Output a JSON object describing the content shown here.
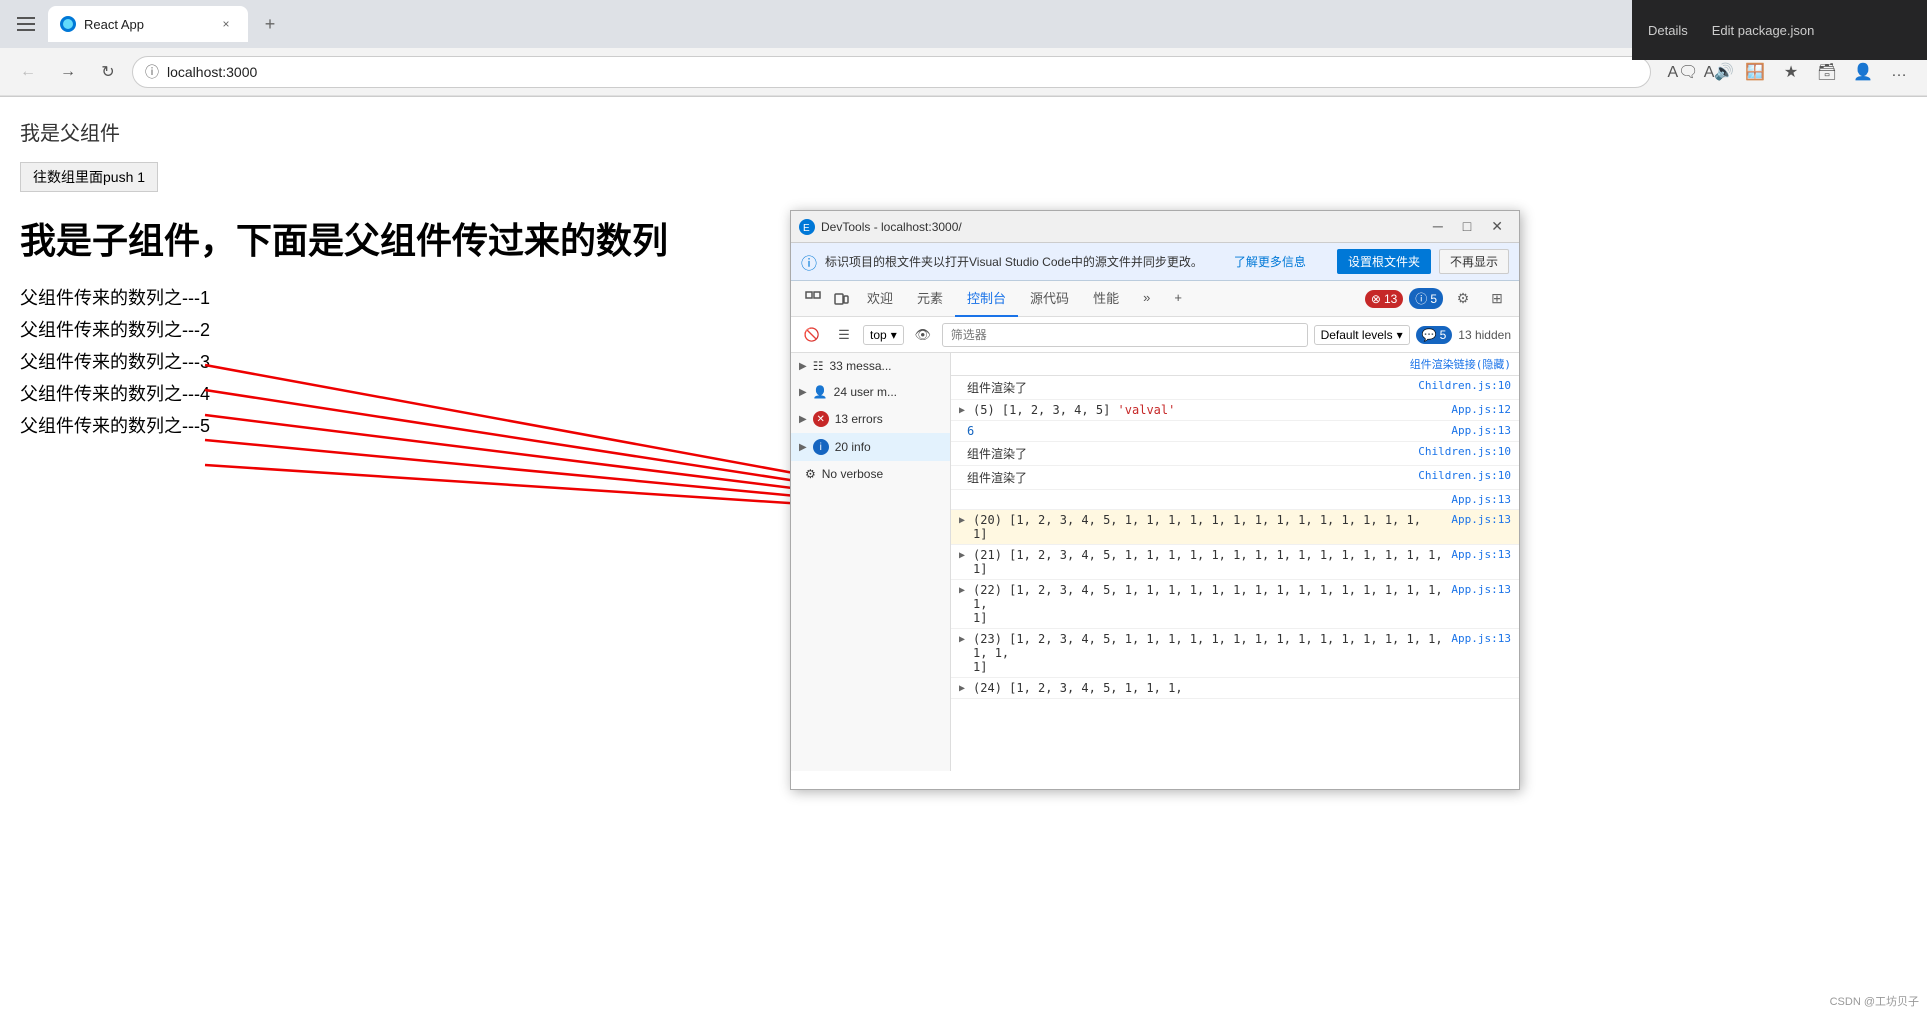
{
  "browser": {
    "tab_title": "React App",
    "tab_favicon": "R",
    "url": "localhost:3000",
    "new_tab_label": "+",
    "close_tab_label": "×"
  },
  "page": {
    "parent_label": "我是父组件",
    "push_button": "往数组里面push 1",
    "child_heading": "我是子组件，下面是父组件传过来的数列",
    "list_items": [
      "父组件传来的数列之---1",
      "父组件传来的数列之---2",
      "父组件传来的数列之---3",
      "父组件传来的数列之---4",
      "父组件传来的数列之---5"
    ]
  },
  "devtools": {
    "title": "DevTools - localhost:3000/",
    "info_bar_text": "标识项目的根文件夹以打开Visual Studio Code中的源文件并同步更改。",
    "info_bar_link": "了解更多信息",
    "btn_set_root": "设置根文件夹",
    "btn_no_more": "不再显示",
    "tabs": [
      "欢迎",
      "元素",
      "控制台",
      "源代码",
      "性能"
    ],
    "active_tab": "控制台",
    "badge_errors": "13",
    "badge_info": "5",
    "toolbar": {
      "top_label": "top",
      "filter_placeholder": "筛选器",
      "levels_label": "Default levels",
      "msg_count": "5",
      "hidden_count": "13 hidden"
    },
    "sidebar_items": [
      {
        "label": "33 messa...",
        "type": "list",
        "count": "33"
      },
      {
        "label": "24 user m...",
        "type": "user",
        "count": "24"
      },
      {
        "label": "13 errors",
        "type": "error",
        "count": "13"
      },
      {
        "label": "20 info",
        "type": "info",
        "count": "20",
        "active": true
      },
      {
        "label": "No verbose",
        "type": "verbose",
        "count": ""
      }
    ],
    "log_entries": [
      {
        "expand": true,
        "content": "组件渲染了",
        "source": "Children.js:10"
      },
      {
        "expand": true,
        "content": "▶ (5) [1, 2, 3, 4, 5] 'valval'",
        "source": "App.js:12"
      },
      {
        "expand": false,
        "content": "6",
        "source": "App.js:13"
      },
      {
        "expand": false,
        "content": "组件渲染了",
        "source": "Children.js:10"
      },
      {
        "expand": false,
        "content": "组件渲染了",
        "source": "Children.js:10"
      },
      {
        "expand": false,
        "content": "",
        "source": "App.js:13"
      },
      {
        "expand": true,
        "content": "▶ (20) [1, 2, 3, 4, 5, 1, 1, 1, 1, 1, 1, 1, 1, 1, 1, 1, 1, 1, 1, 1]",
        "source": "App.js:13"
      },
      {
        "expand": true,
        "content": "▶ (21) [1, 2, 3, 4, 5, 1, 1, 1, 1, 1, 1, 1, 1, 1, 1, 1, 1, 1, 1, 1, 1]",
        "source": "App.js:13"
      },
      {
        "expand": true,
        "content": "▶ (22) [1, 2, 3, 4, 5, 1, 1, 1, 1, 1, 1, 1, 1, 1, 1, 1, 1, 1, 1, 1, 1, 1]",
        "source": "App.js:13"
      },
      {
        "expand": true,
        "content": "▶ (23) [1, 2, 3, 4, 5, 1, 1, 1, 1, 1, 1, 1, 1, 1, 1, 1, 1, 1, 1, 1, 1, 1, 1]",
        "source": "App.js:13"
      },
      {
        "expand": true,
        "content": "▶ (24) [1, 2, 3, 4, 5, 1, 1, 1,",
        "source": ""
      }
    ]
  },
  "vscode": {
    "details_label": "Details",
    "edit_package_label": "Edit package.json"
  }
}
